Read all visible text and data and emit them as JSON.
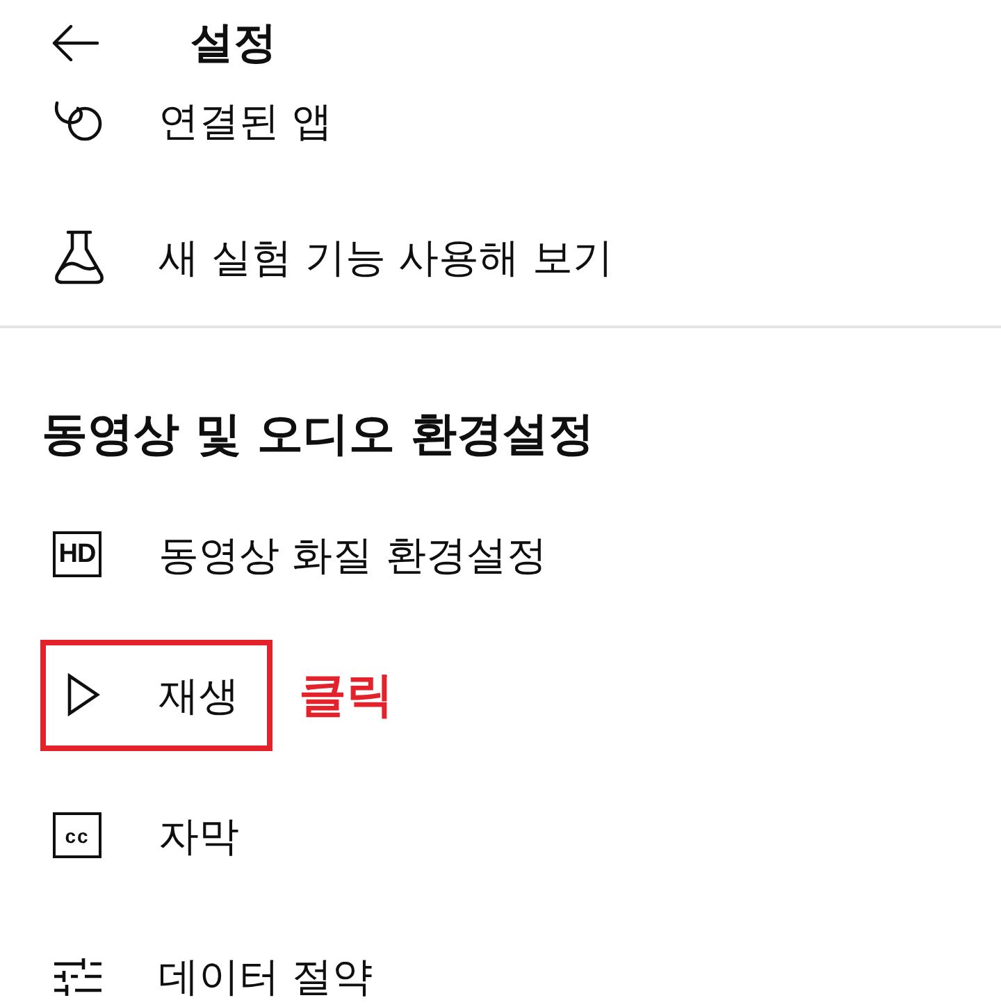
{
  "header": {
    "title": "설정"
  },
  "general_items": [
    {
      "label": "연결된 앱"
    },
    {
      "label": "새 실험 기능 사용해 보기"
    }
  ],
  "video_audio_section": {
    "heading": "동영상 및 오디오 환경설정",
    "items": [
      {
        "label": "동영상 화질 환경설정",
        "icon_text": "HD",
        "highlighted": false
      },
      {
        "label": "재생",
        "highlighted": true,
        "annotation": "클릭"
      },
      {
        "label": "자막",
        "icon_text": "cc",
        "highlighted": false
      },
      {
        "label": "데이터 절약",
        "highlighted": false
      }
    ]
  }
}
